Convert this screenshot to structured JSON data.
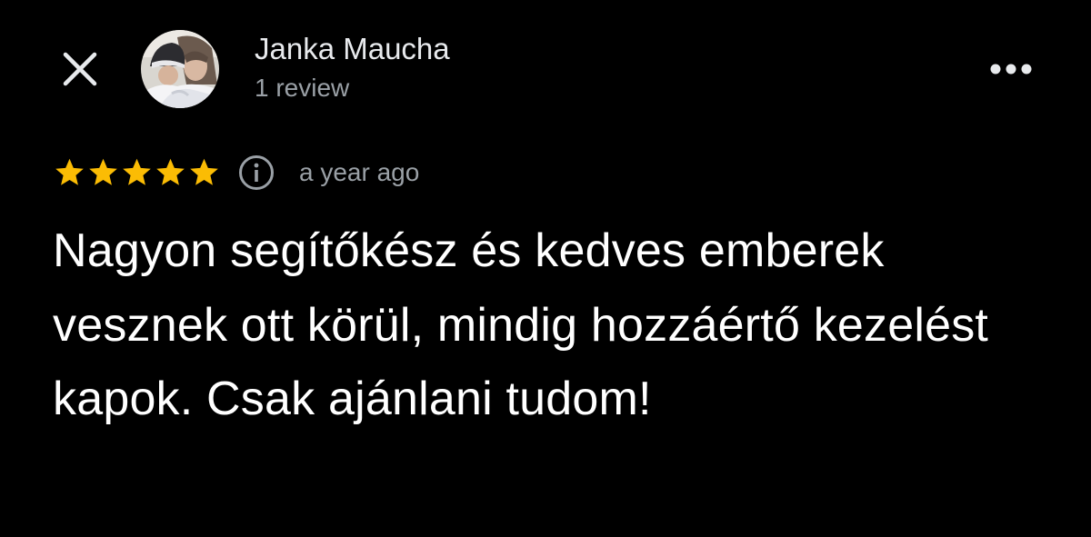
{
  "header": {
    "close_icon": "close-icon",
    "more_icon": "more-horizontal-icon",
    "author": {
      "name": "Janka Maucha",
      "meta": "1 review",
      "avatar_icon": "avatar-photo"
    }
  },
  "review": {
    "rating": 5,
    "rating_max": 5,
    "info_icon": "info-icon",
    "time": "a year ago",
    "text": "Nagyon segítőkész és kedves emberek vesznek ott körül, mindig hozzáértő kezelést kapok. Csak ajánlani tudom!"
  },
  "colors": {
    "background": "#000000",
    "star": "#fbbc04",
    "text_primary": "#ffffff",
    "text_secondary": "#9aa0a6"
  }
}
